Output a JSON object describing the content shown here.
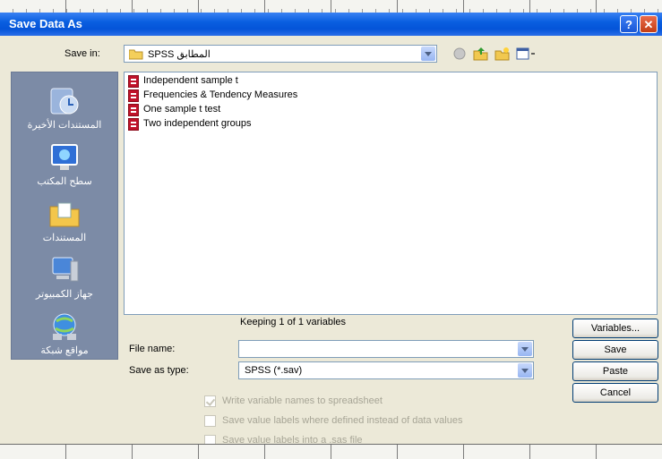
{
  "dialog": {
    "title": "Save Data As",
    "help_label": "?",
    "close_label": "✕"
  },
  "save_in": {
    "label": "Save in:",
    "value": "SPSS المطابق"
  },
  "toolbar": {
    "back_icon": "back-icon",
    "up_icon": "up-folder-icon",
    "new_folder_icon": "new-folder-icon",
    "views_icon": "views-menu-icon"
  },
  "places": [
    {
      "label": "المستندات الأخيرة",
      "icon": "recent-documents-icon"
    },
    {
      "label": "سطح المكتب",
      "icon": "desktop-icon"
    },
    {
      "label": "المستندات",
      "icon": "my-documents-icon"
    },
    {
      "label": "جهاز الكمبيوتر",
      "icon": "my-computer-icon"
    },
    {
      "label": "مواقع شبكة",
      "icon": "network-places-icon"
    }
  ],
  "files": [
    "Independent sample t",
    "Frequencies & Tendency Measures",
    "One sample t test",
    "Two independent groups"
  ],
  "keeping_text": "Keeping 1 of 1 variables",
  "file_name": {
    "label": "File name:",
    "value": ""
  },
  "save_as_type": {
    "label": "Save as type:",
    "value": "SPSS (*.sav)"
  },
  "buttons": {
    "variables": "Variables...",
    "save": "Save",
    "paste": "Paste",
    "cancel": "Cancel"
  },
  "options": [
    {
      "label": "Write variable names to spreadsheet",
      "checked": true
    },
    {
      "label": "Save value labels where defined instead of data values",
      "checked": false
    },
    {
      "label": "Save value labels into a .sas file",
      "checked": false
    }
  ]
}
